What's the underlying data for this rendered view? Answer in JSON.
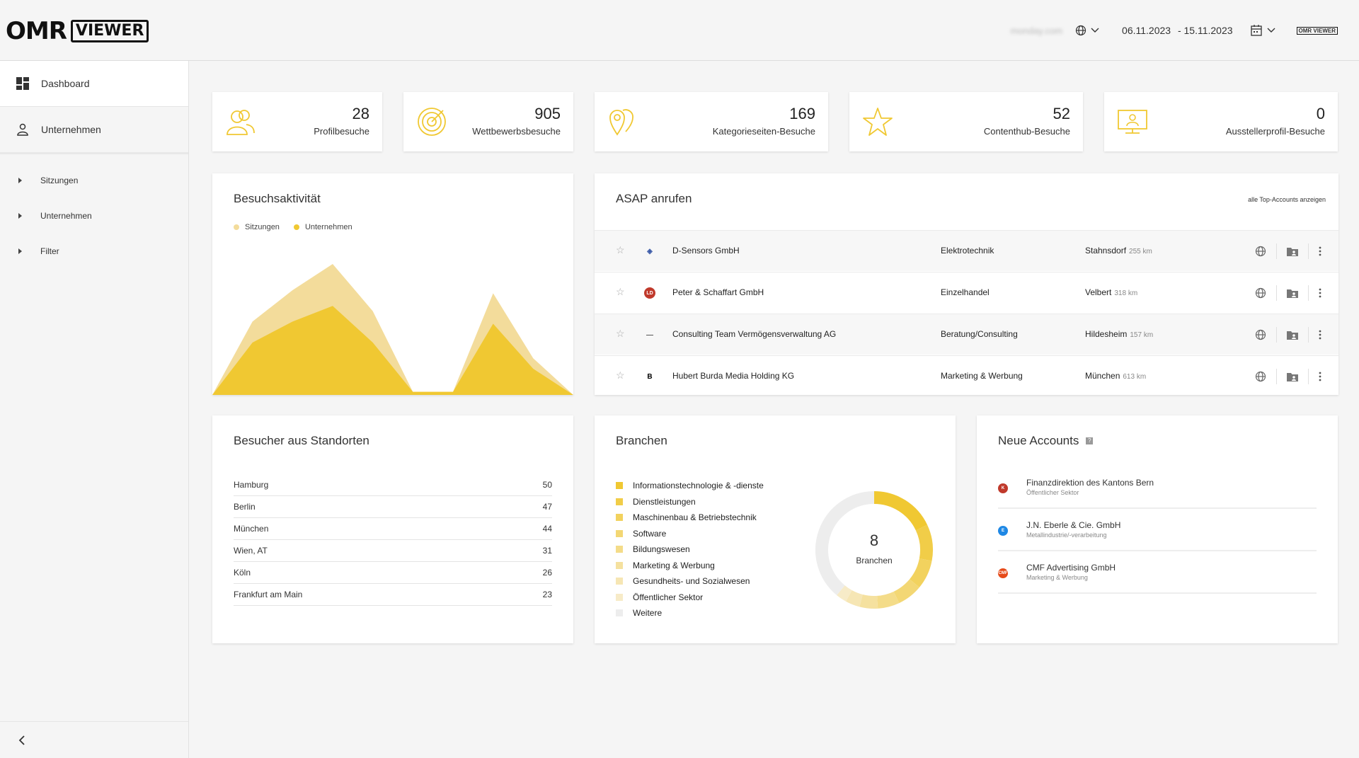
{
  "header": {
    "logo_omr": "OMR",
    "logo_viewer": "VIEWER",
    "domain": "monday.com",
    "date_from": "06.11.2023",
    "date_to": "- 15.11.2023",
    "small_logo": "OMR VIEWER"
  },
  "sidebar": {
    "main": [
      {
        "label": "Dashboard",
        "icon": "dashboard-icon"
      },
      {
        "label": "Unternehmen",
        "icon": "person-icon"
      }
    ],
    "sub": [
      {
        "label": "Sitzungen"
      },
      {
        "label": "Unternehmen"
      },
      {
        "label": "Filter"
      }
    ]
  },
  "stats": [
    {
      "value": "28",
      "label": "Profilbesuche",
      "icon": "people-icon"
    },
    {
      "value": "905",
      "label": "Wettbewerbsbesuche",
      "icon": "target-icon"
    },
    {
      "value": "169",
      "label": "Kategorieseiten-Besuche",
      "icon": "map-pin-icon"
    },
    {
      "value": "52",
      "label": "Contenthub-Besuche",
      "icon": "star-icon"
    },
    {
      "value": "0",
      "label": "Ausstellerprofil-Besuche",
      "icon": "monitor-icon"
    }
  ],
  "activity": {
    "title": "Besuchsaktivität",
    "legend": [
      "Sitzungen",
      "Unternehmen"
    ]
  },
  "chart_data": {
    "type": "area",
    "series": [
      {
        "name": "Sitzungen",
        "values": [
          0,
          70,
          100,
          125,
          80,
          3,
          3,
          97,
          35,
          0
        ]
      },
      {
        "name": "Unternehmen",
        "values": [
          0,
          50,
          70,
          85,
          50,
          3,
          3,
          68,
          25,
          0
        ]
      }
    ],
    "colors": [
      "#f3dc9b",
      "#f0c832"
    ],
    "grid": false,
    "legend_position": "top-left"
  },
  "asap": {
    "title": "ASAP anrufen",
    "link": "alle Top-Accounts anzeigen",
    "rows": [
      {
        "logo": "◈",
        "logo_color": "#3b5aa8",
        "name": "D-Sensors GmbH",
        "industry": "Elektrotechnik",
        "city": "Stahnsdorf",
        "km": "255 km"
      },
      {
        "logo": "LD",
        "logo_color": "#c0392b",
        "name": "Peter & Schaffart GmbH",
        "industry": "Einzelhandel",
        "city": "Velbert",
        "km": "318 km"
      },
      {
        "logo": "—",
        "logo_color": "#555555",
        "name": "Consulting Team Vermögensverwaltung AG",
        "industry": "Beratung/Consulting",
        "city": "Hildesheim",
        "km": "157 km"
      },
      {
        "logo": "B",
        "logo_color": "#000000",
        "name": "Hubert Burda Media Holding KG",
        "industry": "Marketing & Werbung",
        "city": "München",
        "km": "613 km"
      }
    ]
  },
  "locations": {
    "title": "Besucher aus Standorten",
    "rows": [
      {
        "city": "Hamburg",
        "count": "50"
      },
      {
        "city": "Berlin",
        "count": "47"
      },
      {
        "city": "München",
        "count": "44"
      },
      {
        "city": "Wien, AT",
        "count": "31"
      },
      {
        "city": "Köln",
        "count": "26"
      },
      {
        "city": "Frankfurt am Main",
        "count": "23"
      }
    ]
  },
  "branchen": {
    "title": "Branchen",
    "count": "8",
    "count_label": "Branchen",
    "items": [
      {
        "label": "Informationstechnologie & -dienste",
        "color": "#f0c832"
      },
      {
        "label": "Dienstleistungen",
        "color": "#f1cd48"
      },
      {
        "label": "Maschinenbau & Betriebstechnik",
        "color": "#f2d25e"
      },
      {
        "label": "Software",
        "color": "#f3d774"
      },
      {
        "label": "Bildungswesen",
        "color": "#f4dc89"
      },
      {
        "label": "Marketing & Werbung",
        "color": "#f5e19f"
      },
      {
        "label": "Gesundheits- und Sozialwesen",
        "color": "#f6e6b4"
      },
      {
        "label": "Öffentlicher Sektor",
        "color": "#f7ebc8"
      },
      {
        "label": "Weitere",
        "color": "#ededed"
      }
    ],
    "donut_values": [
      18,
      10,
      8,
      7,
      6,
      5,
      4,
      3,
      39
    ]
  },
  "accounts": {
    "title": "Neue Accounts",
    "rows": [
      {
        "logo": "K",
        "logo_color": "#c0392b",
        "name": "Finanzdirektion des Kantons Bern",
        "sector": "Öffentlicher Sektor"
      },
      {
        "logo": "E",
        "logo_color": "#1e88e5",
        "name": "J.N. Eberle & Cie. GmbH",
        "sector": "Metallindustrie/-verarbeitung"
      },
      {
        "logo": "CMF",
        "logo_color": "#e64a19",
        "name": "CMF Advertising GmbH",
        "sector": "Marketing & Werbung"
      }
    ]
  }
}
